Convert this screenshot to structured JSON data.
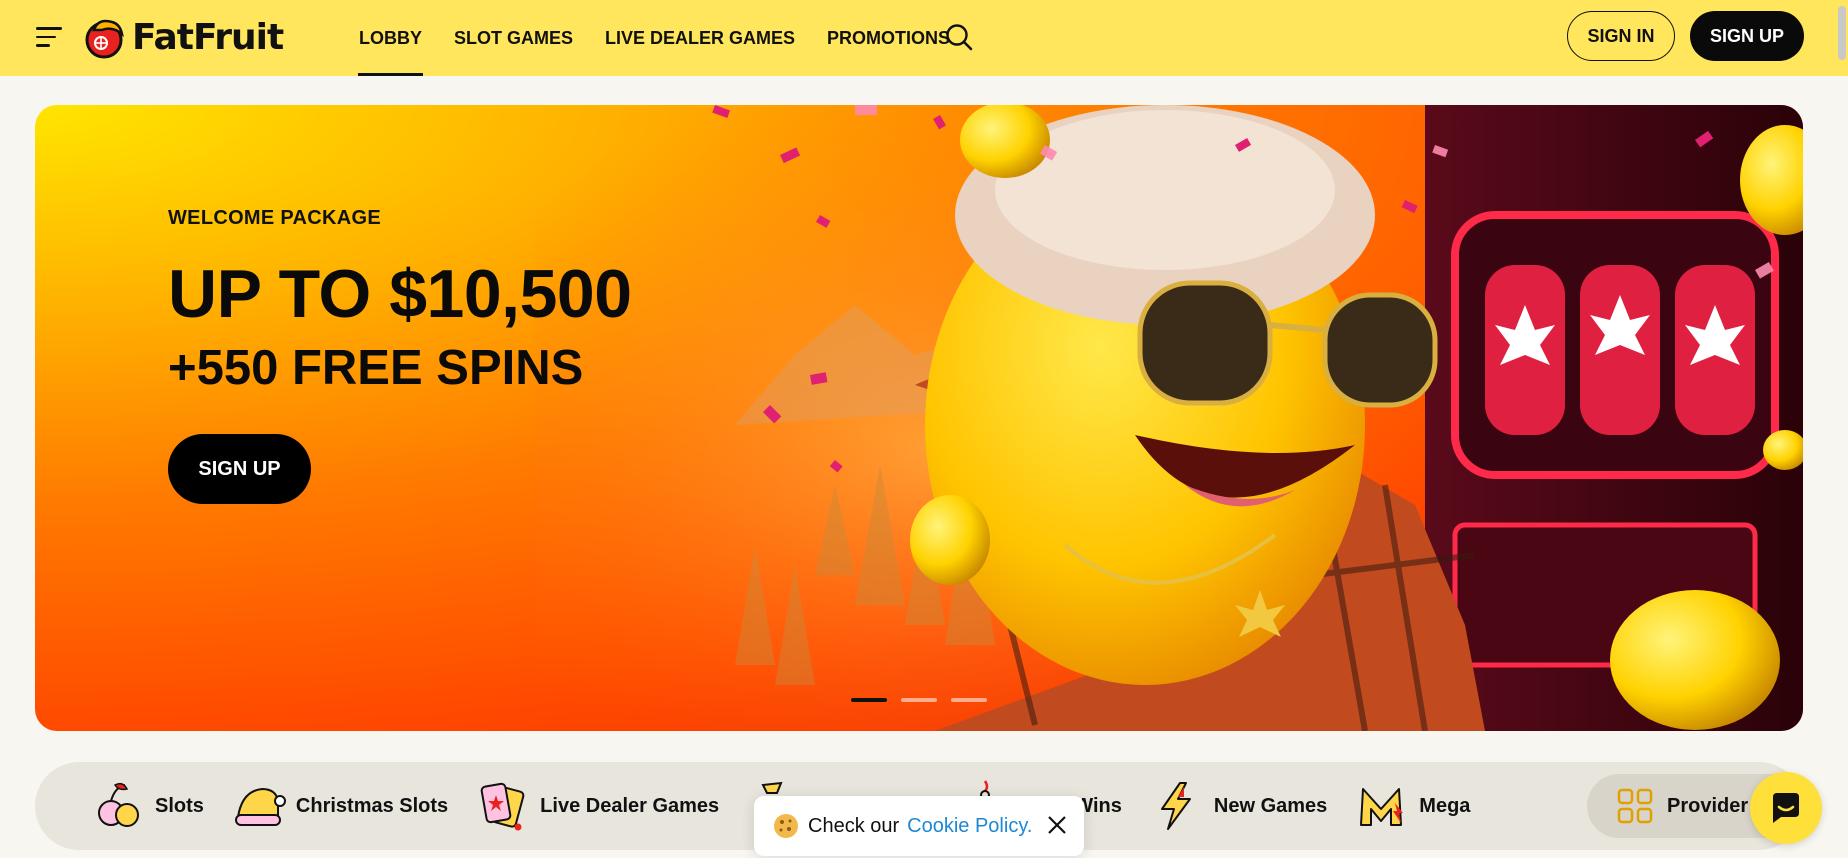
{
  "header": {
    "logo_text": "FatFruit",
    "nav": [
      {
        "label": "LOBBY",
        "active": true
      },
      {
        "label": "SLOT GAMES",
        "active": false
      },
      {
        "label": "LIVE DEALER GAMES",
        "active": false
      },
      {
        "label": "PROMOTIONS",
        "active": false
      }
    ],
    "sign_in": "SIGN IN",
    "sign_up": "SIGN UP",
    "icons": {
      "menu": "hamburger-icon",
      "search": "search-icon"
    }
  },
  "hero": {
    "kicker": "WELCOME PACKAGE",
    "title": "UP TO $10,500",
    "subtitle": "+550 FREE SPINS",
    "cta": "SIGN UP",
    "slides_total": 3,
    "active_slide": 1
  },
  "categories": [
    {
      "label": "Slots",
      "icon": "cherries-icon"
    },
    {
      "label": "Christmas Slots",
      "icon": "santa-hat-icon"
    },
    {
      "label": "Live Dealer Games",
      "icon": "playing-cards-icon"
    },
    {
      "label": "",
      "icon": "money-bag-icon"
    },
    {
      "label": "ops & Wins",
      "icon": "drop-icon"
    },
    {
      "label": "New Games",
      "icon": "lightning-icon"
    },
    {
      "label": "Mega",
      "icon": "mega-m-icon"
    }
  ],
  "providers_label": "Provider",
  "cookie": {
    "text": "Check our",
    "link": "Cookie Policy."
  },
  "colors": {
    "header_bg": "#ffe65c",
    "page_bg": "#f8f6f0",
    "link": "#1e88d6",
    "dark": "#0a0a0a"
  }
}
